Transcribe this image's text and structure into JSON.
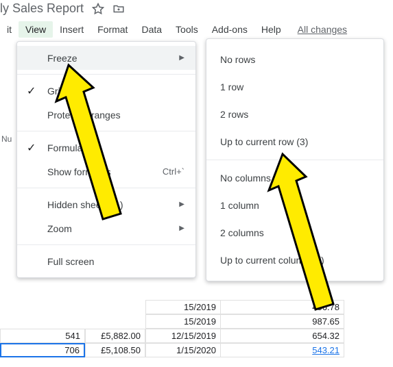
{
  "doc_title": "ly Sales Report",
  "menubar": {
    "edit_partial": "it",
    "view": "View",
    "insert": "Insert",
    "format": "Format",
    "data": "Data",
    "tools": "Tools",
    "addons": "Add-ons",
    "help": "Help",
    "all_changes": "All changes"
  },
  "view_menu": {
    "freeze": "Freeze",
    "gridlines": "Gridlines",
    "protected": "Protected ranges",
    "formula_bar": "Formula bar",
    "show_formulas": "Show formulas",
    "show_formulas_sc": "Ctrl+`",
    "hidden_sheets": "Hidden sheets (1)",
    "zoom": "Zoom",
    "full_screen": "Full screen"
  },
  "freeze_submenu": {
    "no_rows": "No rows",
    "one_row": "1 row",
    "two_rows": "2 rows",
    "up_to_row": "Up to current row (3)",
    "no_cols": "No columns",
    "one_col": "1 column",
    "two_cols": "2 columns",
    "up_to_col": "Up to current column (F)"
  },
  "col_header_partial": "Nu",
  "sheet_rows": [
    {
      "date": "15/2019",
      "val": "456.78"
    },
    {
      "date": "15/2019",
      "val": "987.65"
    },
    {
      "a": "541",
      "b": "£5,882.00",
      "date": "12/15/2019",
      "val": "654.32"
    },
    {
      "a": "706",
      "b": "£5,108.50",
      "date": "1/15/2020",
      "val": "543.21",
      "link": true
    }
  ]
}
